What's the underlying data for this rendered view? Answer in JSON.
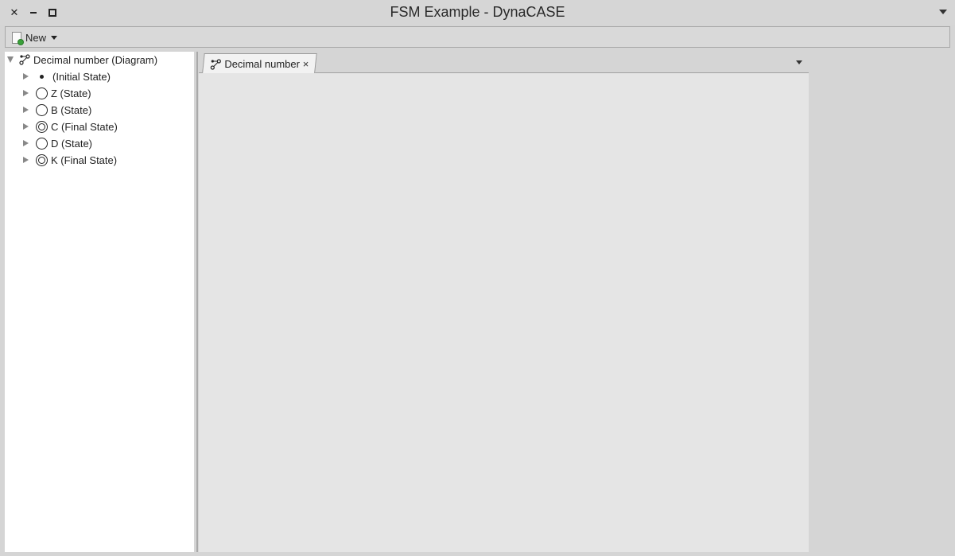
{
  "window": {
    "title": "FSM Example - DynaCASE",
    "close_icon": "✕"
  },
  "toolbar": {
    "new_label": "New"
  },
  "tree": {
    "root": "Decimal number (Diagram)",
    "items": [
      {
        "label": "(Initial State)",
        "kind": "initial"
      },
      {
        "label": "Z (State)",
        "kind": "state"
      },
      {
        "label": "B (State)",
        "kind": "state"
      },
      {
        "label": "C (Final State)",
        "kind": "final"
      },
      {
        "label": "D (State)",
        "kind": "state"
      },
      {
        "label": "K (Final State)",
        "kind": "final"
      }
    ]
  },
  "editor": {
    "tab_label": "Decimal number",
    "tab_close": "×"
  }
}
